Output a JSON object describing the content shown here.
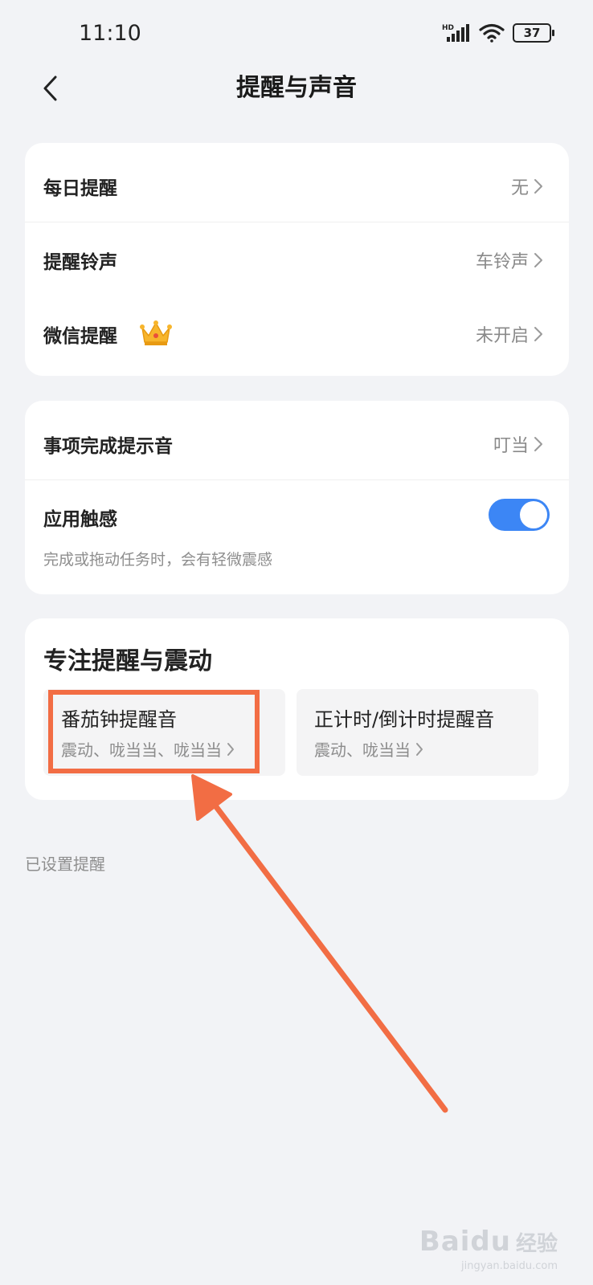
{
  "status_bar": {
    "time": "11:10",
    "network": "HD",
    "battery": "37"
  },
  "nav": {
    "title": "提醒与声音"
  },
  "card1": {
    "rows": [
      {
        "label": "每日提醒",
        "value": "无"
      },
      {
        "label": "提醒铃声",
        "value": "车铃声"
      },
      {
        "label": "微信提醒",
        "value": "未开启",
        "badge": "crown-icon"
      }
    ]
  },
  "card2": {
    "row1": {
      "label": "事项完成提示音",
      "value": "叮当"
    },
    "row2": {
      "label": "应用触感",
      "description": "完成或拖动任务时，会有轻微震感",
      "toggle_on": true
    }
  },
  "focus": {
    "title": "专注提醒与震动",
    "tiles": [
      {
        "title": "番茄钟提醒音",
        "subtitle": "震动、咙当当、咙当当"
      },
      {
        "title": "正计时/倒计时提醒音",
        "subtitle": "震动、咙当当"
      }
    ]
  },
  "footer": {
    "label": "已设置提醒"
  },
  "watermark": {
    "logo": "Baidu",
    "label": "经验",
    "url": "jingyan.baidu.com"
  },
  "colors": {
    "accent": "#3c86f5",
    "annotation": "#f26d44",
    "background": "#f2f3f6"
  }
}
